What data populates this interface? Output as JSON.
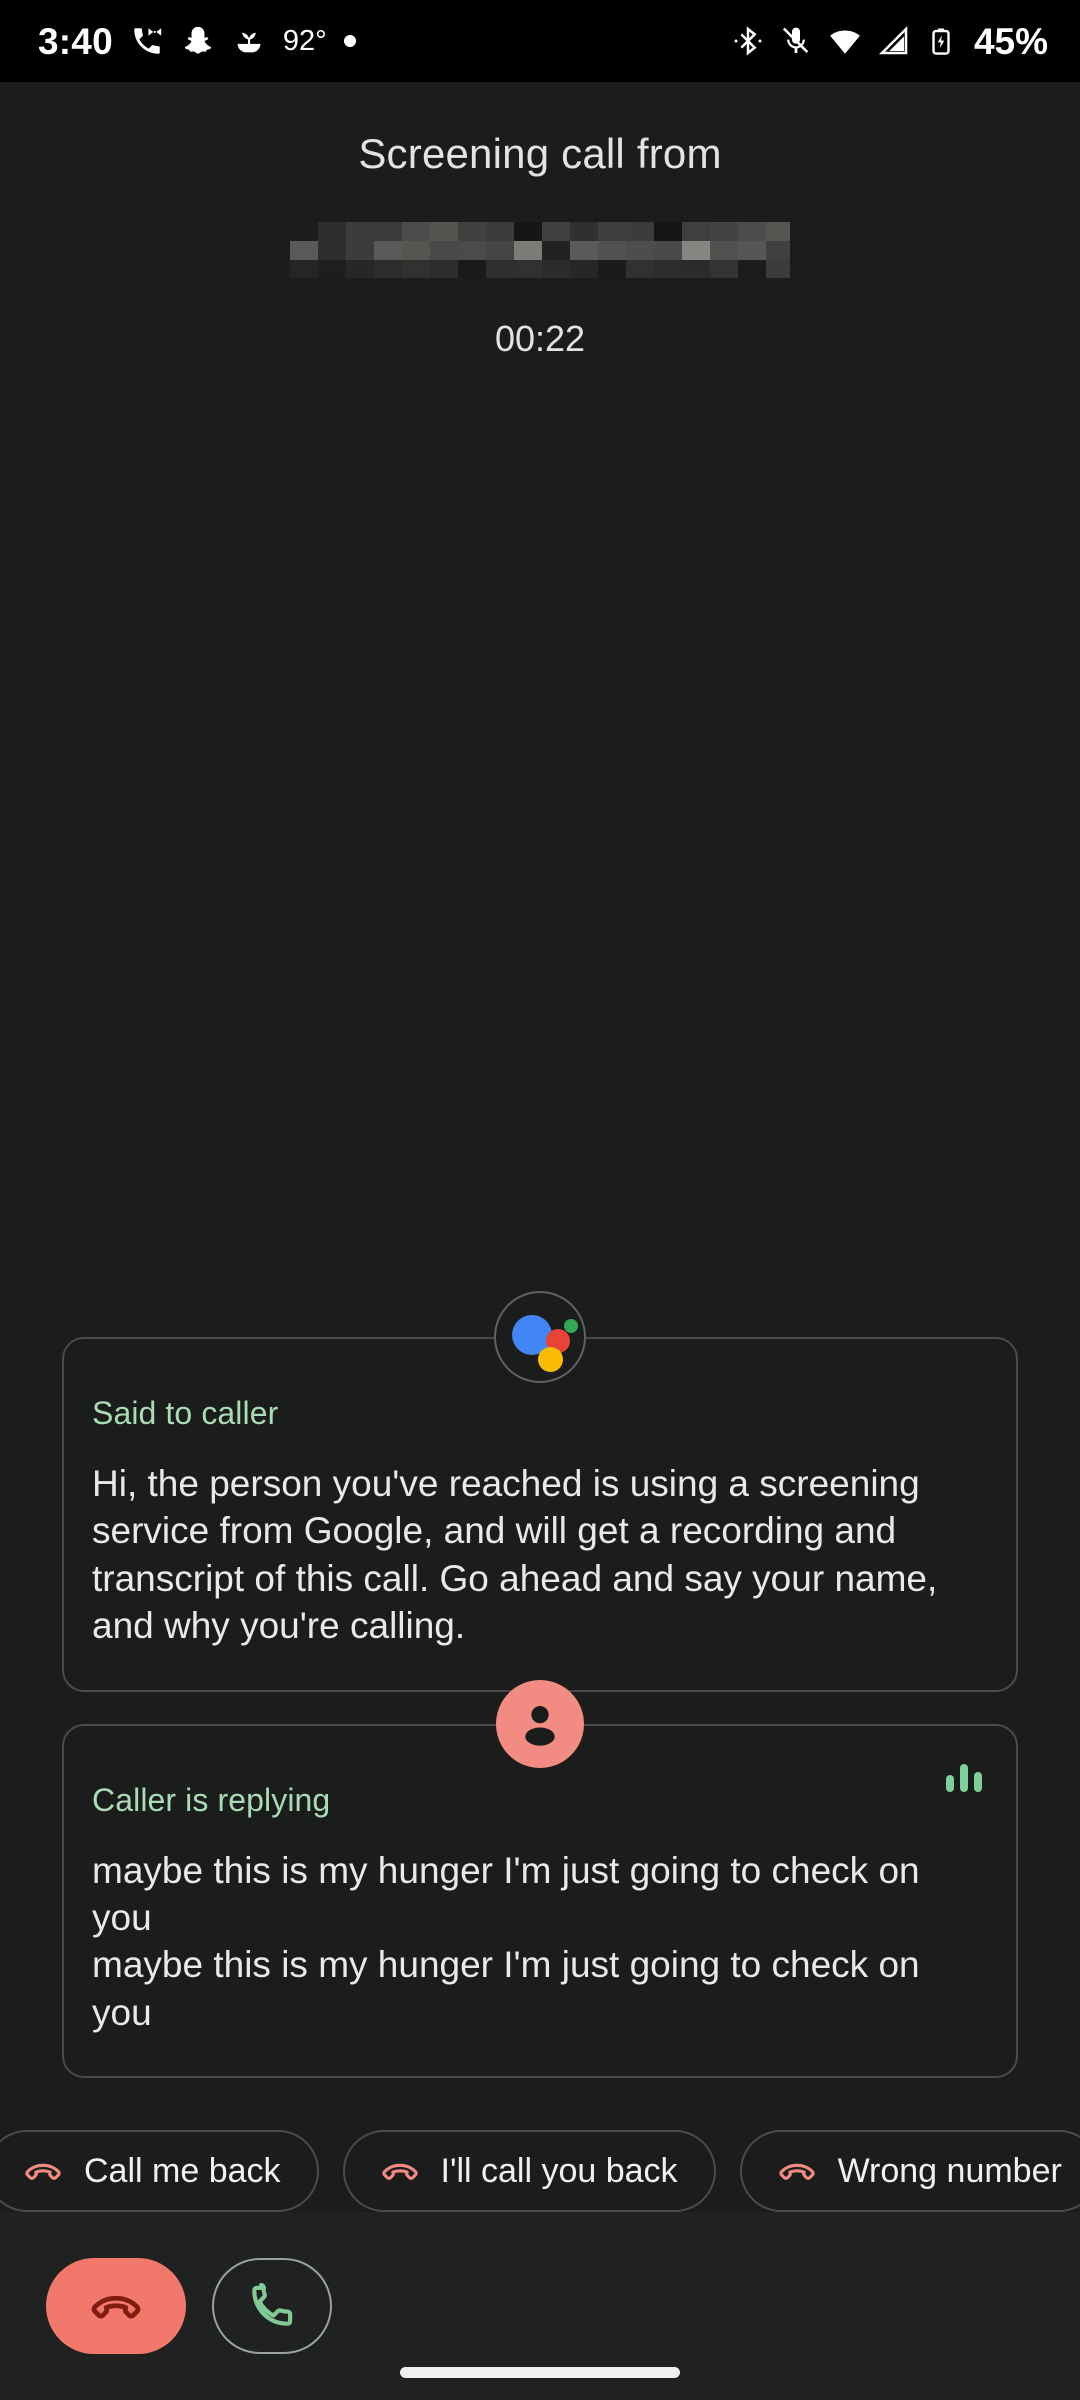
{
  "status_bar": {
    "clock": "3:40",
    "temperature": "92°",
    "battery_percent": "45%",
    "icons_left": [
      "missed-call-icon",
      "snapchat-icon",
      "seedling-icon",
      "notification-dot-icon"
    ],
    "icons_right": [
      "bluetooth-icon",
      "mic-muted-icon",
      "wifi-icon",
      "cellular-signal-icon",
      "battery-charging-icon"
    ]
  },
  "header": {
    "title": "Screening call from",
    "caller_name_redacted": true,
    "timer": "00:22"
  },
  "transcript": [
    {
      "speaker": "assistant",
      "avatar": "google-assistant-icon",
      "label": "Said to caller",
      "text": "Hi, the person you've reached is using a screening service from Google, and will get a recording and transcript of this call. Go ahead and say your name, and why you're calling.",
      "meter_visible": false
    },
    {
      "speaker": "caller",
      "avatar": "person-avatar-icon",
      "label": "Caller is replying",
      "text": "maybe this is my hunger I'm just going to check on you\nmaybe this is my hunger I'm just going to check on you",
      "meter_visible": true
    }
  ],
  "quick_replies": [
    {
      "label": "Call me back",
      "icon": "hangup-phone-icon"
    },
    {
      "label": "I'll call you back",
      "icon": "hangup-phone-icon"
    },
    {
      "label": "Wrong number",
      "icon": "hangup-phone-icon"
    }
  ],
  "call_controls": {
    "end_call": {
      "name": "end-call-button",
      "icon": "hangup-phone-icon"
    },
    "answer_call": {
      "name": "answer-call-button",
      "icon": "phone-icon"
    }
  },
  "colors": {
    "background": "#1b1c1c",
    "bottom_bar": "#202222",
    "label_green": "#a9dcb4",
    "avatar_salmon": "#f28b82",
    "end_call_red": "#f2786c",
    "answer_green": "#81c995",
    "chip_border": "#4a4c4c"
  },
  "nav": {
    "gesture_pill": true
  }
}
